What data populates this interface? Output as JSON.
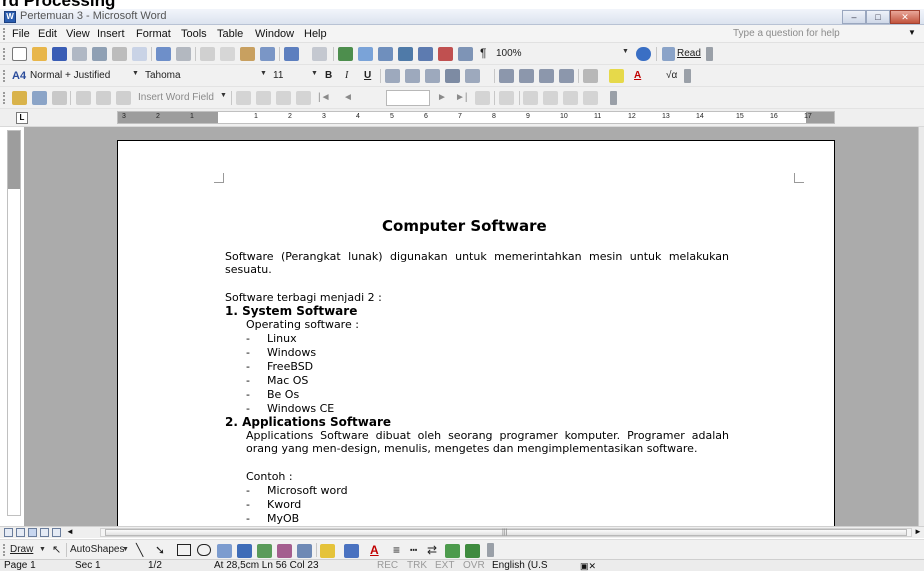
{
  "overlay_heading": "rd Processing",
  "window": {
    "title": "Pertemuan 3 - Microsoft Word",
    "controls": [
      "–",
      "□",
      "✕"
    ]
  },
  "menubar": {
    "items": [
      "File",
      "Edit",
      "View",
      "Insert",
      "Format",
      "Tools",
      "Table",
      "Window",
      "Help"
    ],
    "ask_placeholder": "Type a question for help"
  },
  "toolbars": {
    "standard": {
      "zoom": "100%",
      "read_label": "Read"
    },
    "formatting": {
      "style": "Normal + Justified",
      "font": "Tahoma",
      "size": "11",
      "bold": "B",
      "italic": "I",
      "underline": "U"
    },
    "mailmerge": {
      "insert_word_field": "Insert Word Field"
    }
  },
  "ruler": {
    "labels": [
      "3",
      "2",
      "1",
      "1",
      "2",
      "3",
      "4",
      "5",
      "6",
      "7",
      "8",
      "9",
      "10",
      "11",
      "12",
      "13",
      "14",
      "15",
      "16",
      "17"
    ]
  },
  "document": {
    "title": "Computer Software",
    "intro": "Software (Perangkat lunak) digunakan untuk memerintahkan mesin untuk melakukan sesuatu.",
    "division": "Software terbagi menjadi 2 :",
    "section1": {
      "heading": "1.  System Software",
      "subtitle": "Operating software :",
      "items": [
        "Linux",
        "Windows",
        "FreeBSD",
        "Mac OS",
        "Be Os",
        "Windows CE"
      ]
    },
    "section2": {
      "heading": "2.  Applications Software",
      "paragraph": "Applications Software dibuat oleh seorang programer komputer. Programer adalah orang yang men-design, menulis, mengetes dan mengimplementasikan software.",
      "example": "Contoh :",
      "items": [
        "Microsoft word",
        "Kword",
        "MyOB"
      ]
    },
    "bullet": "-"
  },
  "drawbar": {
    "draw": "Draw",
    "autoshapes": "AutoShapes"
  },
  "statusbar": {
    "page": "Page  1",
    "sec": "Sec  1",
    "pages": "1/2",
    "position": "At  28,5cm   Ln  56   Col  23",
    "rec": "REC",
    "trk": "TRK",
    "ext": "EXT",
    "ovr": "OVR",
    "language": "English (U.S"
  }
}
